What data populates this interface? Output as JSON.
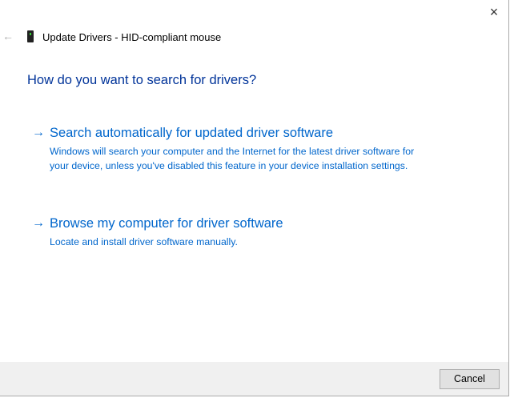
{
  "window": {
    "title": "Update Drivers - HID-compliant mouse",
    "close_icon": "×",
    "back_icon": "←"
  },
  "heading": "How do you want to search for drivers?",
  "options": [
    {
      "arrow": "→",
      "label": "Search automatically for updated driver software",
      "description": "Windows will search your computer and the Internet for the latest driver software for your device, unless you've disabled this feature in your device installation settings."
    },
    {
      "arrow": "→",
      "label": "Browse my computer for driver software",
      "description": "Locate and install driver software manually."
    }
  ],
  "footer": {
    "cancel_label": "Cancel"
  }
}
